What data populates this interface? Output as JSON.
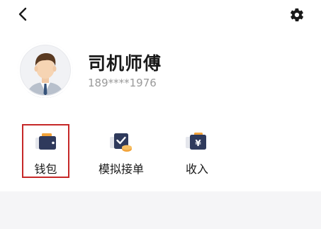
{
  "header": {
    "back_icon": "chevron-left-icon",
    "settings_icon": "gear-icon"
  },
  "profile": {
    "name": "司机师傅",
    "phone": "189****1976",
    "avatar_icon": "driver-avatar"
  },
  "menu": {
    "items": [
      {
        "label": "钱包",
        "icon": "wallet-icon",
        "selected": true
      },
      {
        "label": "模拟接单",
        "icon": "order-check-icon",
        "selected": false
      },
      {
        "label": "收入",
        "icon": "yuan-income-icon",
        "selected": false
      }
    ]
  },
  "colors": {
    "panel": "#ffffff",
    "background": "#f5f5f7",
    "icon_dark": "#2f3a5c",
    "icon_accent": "#f2a33a",
    "highlight_border": "#c62828",
    "phone_text": "#9a9a9a"
  }
}
